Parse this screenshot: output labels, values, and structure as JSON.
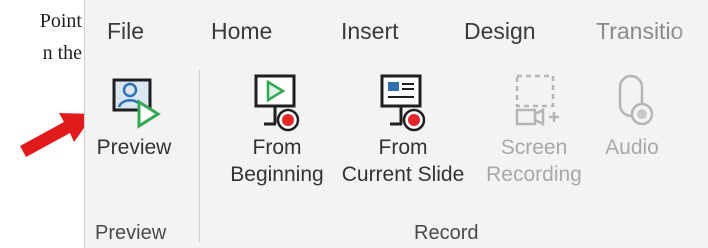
{
  "document_fragment": {
    "line1": "Point",
    "line2": "n the"
  },
  "tabs": [
    "File",
    "Home",
    "Insert",
    "Design",
    "Transitio"
  ],
  "ribbon": {
    "preview_group": {
      "label": "Preview",
      "preview_button": "Preview"
    },
    "record_group": {
      "label": "Record",
      "from_beginning_line1": "From",
      "from_beginning_line2": "Beginning",
      "from_current_line1": "From",
      "from_current_line2": "Current Slide",
      "screen_recording_line1": "Screen",
      "screen_recording_line2": "Recording",
      "audio": "Audio"
    }
  },
  "icons": {
    "preview": "preview-icon",
    "from_beginning": "play-from-beginning-icon",
    "from_current": "play-from-current-slide-icon",
    "screen_recording": "screen-recording-icon",
    "audio": "audio-icon",
    "annotation": "red-arrow-icon"
  },
  "colors": {
    "ribbon_bg": "#f3f3f3",
    "accent_green": "#33a853",
    "accent_blue": "#2f6fb3",
    "record_red": "#e2262a",
    "arrow_red": "#e11b1b"
  }
}
